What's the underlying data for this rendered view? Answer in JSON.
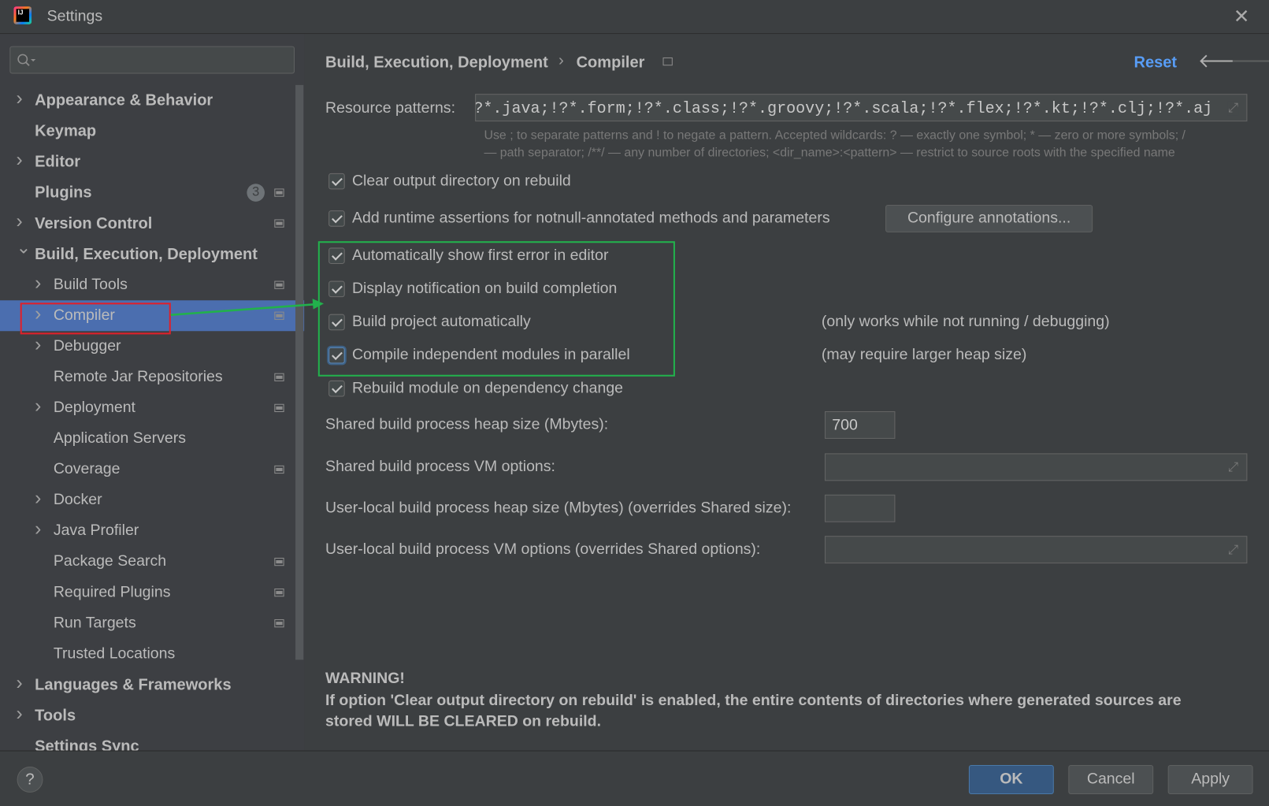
{
  "window": {
    "title": "Settings"
  },
  "sidebar": {
    "search_placeholder": "",
    "items": [
      {
        "label": "Appearance & Behavior",
        "level": 0,
        "chevron": "right"
      },
      {
        "label": "Keymap",
        "level": 0
      },
      {
        "label": "Editor",
        "level": 0,
        "chevron": "right"
      },
      {
        "label": "Plugins",
        "level": 0,
        "badge": "3",
        "project_icon": true
      },
      {
        "label": "Version Control",
        "level": 0,
        "chevron": "right",
        "project_icon": true
      },
      {
        "label": "Build, Execution, Deployment",
        "level": 0,
        "chevron": "down"
      },
      {
        "label": "Build Tools",
        "level": 1,
        "chevron": "right",
        "project_icon": true
      },
      {
        "label": "Compiler",
        "level": 1,
        "chevron": "right",
        "project_icon": true,
        "selected": true
      },
      {
        "label": "Debugger",
        "level": 1,
        "chevron": "right"
      },
      {
        "label": "Remote Jar Repositories",
        "level": 1,
        "project_icon": true
      },
      {
        "label": "Deployment",
        "level": 1,
        "chevron": "right",
        "project_icon": true
      },
      {
        "label": "Application Servers",
        "level": 1
      },
      {
        "label": "Coverage",
        "level": 1,
        "project_icon": true
      },
      {
        "label": "Docker",
        "level": 1,
        "chevron": "right"
      },
      {
        "label": "Java Profiler",
        "level": 1,
        "chevron": "right"
      },
      {
        "label": "Package Search",
        "level": 1,
        "project_icon": true
      },
      {
        "label": "Required Plugins",
        "level": 1,
        "project_icon": true
      },
      {
        "label": "Run Targets",
        "level": 1,
        "project_icon": true
      },
      {
        "label": "Trusted Locations",
        "level": 1
      },
      {
        "label": "Languages & Frameworks",
        "level": 0,
        "chevron": "right"
      },
      {
        "label": "Tools",
        "level": 0,
        "chevron": "right"
      },
      {
        "label": "Settings Sync",
        "level": 0
      }
    ]
  },
  "header": {
    "breadcrumb": [
      "Build, Execution, Deployment",
      "Compiler"
    ],
    "separator": "›",
    "reset": "Reset",
    "back_icon": "arrow-left-icon",
    "forward_icon": "arrow-right-icon"
  },
  "main": {
    "resource_label": "Resource patterns:",
    "resource_value": "!?*.java;!?*.form;!?*.class;!?*.groovy;!?*.scala;!?*.flex;!?*.kt;!?*.clj;!?*.aj",
    "help_line1": "Use ; to separate patterns and ! to negate a pattern. Accepted wildcards: ? — exactly one symbol; * — zero or more symbols; /",
    "help_line2": "— path separator; /**/ — any number of directories; <dir_name>:<pattern> — restrict to source roots with the specified name",
    "checkboxes": [
      {
        "label": "Clear output directory on rebuild",
        "checked": true
      },
      {
        "label": "Add runtime assertions for notnull-annotated methods and parameters",
        "checked": true
      },
      {
        "label": "Automatically show first error in editor",
        "checked": true
      },
      {
        "label": "Display notification on build completion",
        "checked": true
      },
      {
        "label": "Build project automatically",
        "checked": true,
        "note": "(only works while not running / debugging)"
      },
      {
        "label": "Compile independent modules in parallel",
        "checked": true,
        "focused": true,
        "note": "(may require larger heap size)"
      },
      {
        "label": "Rebuild module on dependency change",
        "checked": true
      }
    ],
    "configure_button": "Configure annotations...",
    "fields": [
      {
        "label": "Shared build process heap size (Mbytes):",
        "value": "700"
      },
      {
        "label": "Shared build process VM options:",
        "value": ""
      },
      {
        "label": "User-local build process heap size (Mbytes) (overrides Shared size):",
        "value": ""
      },
      {
        "label": "User-local build process VM options (overrides Shared options):",
        "value": ""
      }
    ],
    "warning_title": "WARNING!",
    "warning_line1": "If option 'Clear output directory on rebuild' is enabled, the entire contents of directories where generated sources are",
    "warning_line2": "stored WILL BE CLEARED on rebuild."
  },
  "footer": {
    "help": "?",
    "ok": "OK",
    "cancel": "Cancel",
    "apply": "Apply"
  },
  "colors": {
    "accent": "#4b6eaf",
    "link": "#589df6",
    "annotation_red": "#e0202a",
    "annotation_green": "#22b14c",
    "ok_button": "#365880"
  }
}
